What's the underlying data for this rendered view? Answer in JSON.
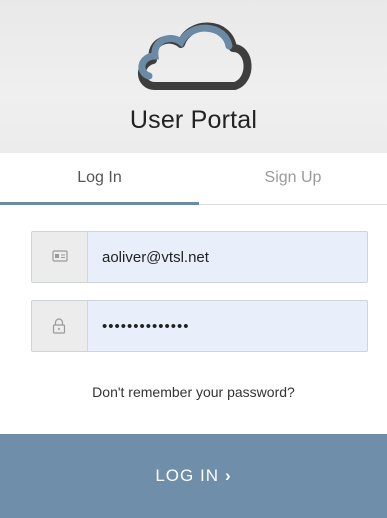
{
  "header": {
    "title": "User Portal"
  },
  "tabs": [
    {
      "label": "Log In",
      "active": true
    },
    {
      "label": "Sign Up",
      "active": false
    }
  ],
  "form": {
    "email": {
      "value": "aoliver@vtsl.net",
      "icon": "id-card-icon"
    },
    "password": {
      "value": "••••••••••••••",
      "icon": "lock-icon"
    },
    "forgot_link": "Don't remember your password?",
    "submit_label": "LOG IN",
    "submit_icon": "chevron-right-icon"
  },
  "colors": {
    "accent": "#6f8ea9",
    "input_bg": "#e8effb",
    "header_bg": "#ececec",
    "logo_dark": "#3e3e3e",
    "logo_blue": "#6b8aa5"
  }
}
